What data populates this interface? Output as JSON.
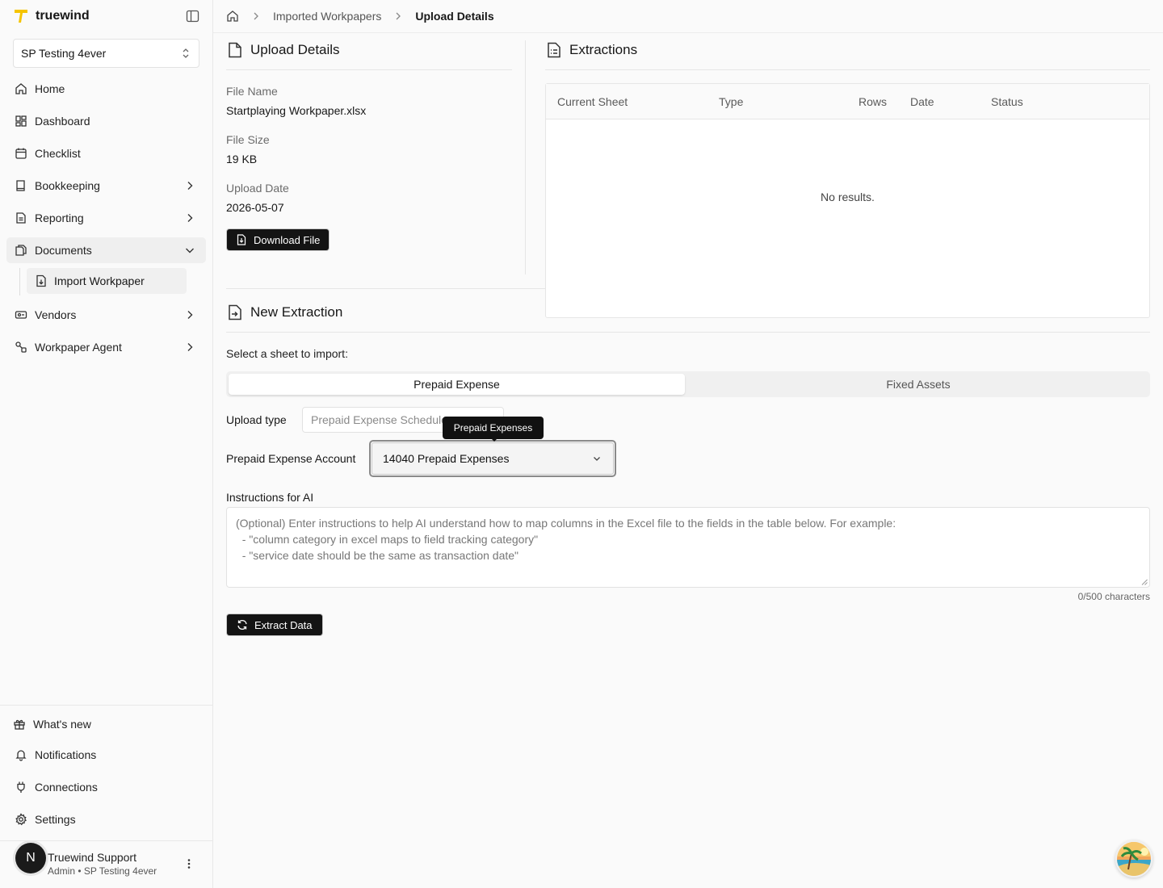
{
  "brand": {
    "name": "truewind",
    "accent": "#f5c400"
  },
  "org_select": {
    "value": "SP Testing 4ever"
  },
  "nav": {
    "home": "Home",
    "dashboard": "Dashboard",
    "checklist": "Checklist",
    "bookkeeping": "Bookkeeping",
    "reporting": "Reporting",
    "documents": "Documents",
    "import_workpaper": "Import Workpaper",
    "vendors": "Vendors",
    "workpaper_agent": "Workpaper Agent"
  },
  "footer_nav": {
    "whats_new": "What's new",
    "notifications": "Notifications",
    "connections": "Connections",
    "settings": "Settings"
  },
  "user": {
    "initial": "N",
    "name": "Truewind Support",
    "role": "Admin • SP Testing 4ever"
  },
  "breadcrumb": {
    "parent": "Imported Workpapers",
    "current": "Upload Details"
  },
  "upload_details": {
    "title": "Upload Details",
    "file_name_label": "File Name",
    "file_name": "Startplaying Workpaper.xlsx",
    "file_size_label": "File Size",
    "file_size": "19 KB",
    "upload_date_label": "Upload Date",
    "upload_date": "2026-05-07",
    "download_button": "Download File"
  },
  "extractions": {
    "title": "Extractions",
    "columns": [
      "Current Sheet",
      "Type",
      "Rows",
      "Date",
      "Status"
    ],
    "empty_message": "No results."
  },
  "new_extraction": {
    "title": "New Extraction",
    "sheet_prompt": "Select a sheet to import:",
    "tabs": [
      "Prepaid Expense",
      "Fixed Assets"
    ],
    "active_tab": "Prepaid Expense",
    "upload_type_label": "Upload type",
    "upload_type_value": "Prepaid Expense Schedule",
    "account_label": "Prepaid Expense Account",
    "account_value": "14040 Prepaid Expenses",
    "tooltip": "Prepaid Expenses",
    "instructions_label": "Instructions for AI",
    "instructions_placeholder": "(Optional) Enter instructions to help AI understand how to map columns in the Excel file to the fields in the table below. For example:\n  - \"column category in excel maps to field tracking category\"\n  - \"service date should be the same as transaction date\"",
    "char_count": "0/500 characters",
    "extract_button": "Extract Data"
  }
}
